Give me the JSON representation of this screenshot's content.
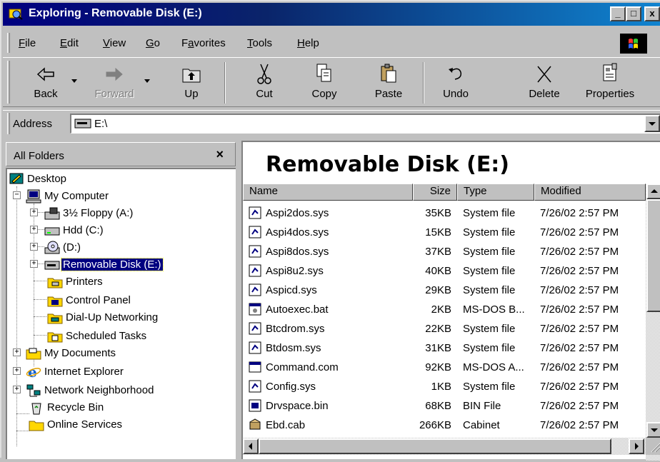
{
  "window": {
    "title": "Exploring - Removable Disk (E:)",
    "title_color": "#000080",
    "minimize_glyph": "_",
    "maximize_glyph": "□",
    "close_glyph": "x"
  },
  "menu": {
    "items": [
      {
        "accel": "F",
        "rest": "ile"
      },
      {
        "accel": "E",
        "rest": "dit"
      },
      {
        "accel": "V",
        "rest": "iew"
      },
      {
        "accel": "G",
        "rest": "o"
      },
      {
        "pre": "F",
        "accel": "a",
        "rest": "vorites"
      },
      {
        "accel": "T",
        "rest": "ools"
      },
      {
        "accel": "H",
        "rest": "elp"
      }
    ]
  },
  "toolbar": {
    "back": "Back",
    "forward": "Forward",
    "up": "Up",
    "cut": "Cut",
    "copy": "Copy",
    "paste": "Paste",
    "undo": "Undo",
    "delete": "Delete",
    "properties": "Properties"
  },
  "address": {
    "label": "Address",
    "value": "E:\\"
  },
  "folders": {
    "header": "All Folders",
    "close_glyph": "×",
    "tree": [
      {
        "label": "Desktop",
        "icon": "desktop-icon"
      },
      {
        "label": "My Computer",
        "icon": "computer-icon"
      },
      {
        "label": "3½ Floppy (A:)",
        "icon": "floppy-icon"
      },
      {
        "label": "Hdd (C:)",
        "icon": "hard-drive-icon"
      },
      {
        "label": " (D:)",
        "icon": "cd-drive-icon"
      },
      {
        "label": "Removable Disk (E:)",
        "icon": "removable-disk-icon"
      },
      {
        "label": "Printers",
        "icon": "printers-folder-icon"
      },
      {
        "label": "Control Panel",
        "icon": "control-panel-icon"
      },
      {
        "label": "Dial-Up Networking",
        "icon": "dialup-icon"
      },
      {
        "label": "Scheduled Tasks",
        "icon": "scheduled-tasks-icon"
      },
      {
        "label": "My Documents",
        "icon": "folder-icon"
      },
      {
        "label": "Internet Explorer",
        "icon": "ie-icon"
      },
      {
        "label": "Network Neighborhood",
        "icon": "network-icon"
      },
      {
        "label": "Recycle Bin",
        "icon": "recycle-bin-icon"
      },
      {
        "label": "Online Services",
        "icon": "folder-icon"
      }
    ]
  },
  "content": {
    "title": "Removable Disk (E:)",
    "columns": {
      "name": "Name",
      "size": "Size",
      "type": "Type",
      "modified": "Modified"
    },
    "files": [
      {
        "name": "Aspi2dos.sys",
        "size": "35KB",
        "type": "System file",
        "modified": "7/26/02 2:57 PM",
        "icon": "sys-file-icon"
      },
      {
        "name": "Aspi4dos.sys",
        "size": "15KB",
        "type": "System file",
        "modified": "7/26/02 2:57 PM",
        "icon": "sys-file-icon"
      },
      {
        "name": "Aspi8dos.sys",
        "size": "37KB",
        "type": "System file",
        "modified": "7/26/02 2:57 PM",
        "icon": "sys-file-icon"
      },
      {
        "name": "Aspi8u2.sys",
        "size": "40KB",
        "type": "System file",
        "modified": "7/26/02 2:57 PM",
        "icon": "sys-file-icon"
      },
      {
        "name": "Aspicd.sys",
        "size": "29KB",
        "type": "System file",
        "modified": "7/26/02 2:57 PM",
        "icon": "sys-file-icon"
      },
      {
        "name": "Autoexec.bat",
        "size": "2KB",
        "type": "MS-DOS B...",
        "modified": "7/26/02 2:57 PM",
        "icon": "bat-file-icon"
      },
      {
        "name": "Btcdrom.sys",
        "size": "22KB",
        "type": "System file",
        "modified": "7/26/02 2:57 PM",
        "icon": "sys-file-icon"
      },
      {
        "name": "Btdosm.sys",
        "size": "31KB",
        "type": "System file",
        "modified": "7/26/02 2:57 PM",
        "icon": "sys-file-icon"
      },
      {
        "name": "Command.com",
        "size": "92KB",
        "type": "MS-DOS A...",
        "modified": "7/26/02 2:57 PM",
        "icon": "com-file-icon"
      },
      {
        "name": "Config.sys",
        "size": "1KB",
        "type": "System file",
        "modified": "7/26/02 2:57 PM",
        "icon": "sys-file-icon"
      },
      {
        "name": "Drvspace.bin",
        "size": "68KB",
        "type": "BIN File",
        "modified": "7/26/02 2:57 PM",
        "icon": "bin-file-icon"
      },
      {
        "name": "Ebd.cab",
        "size": "266KB",
        "type": "Cabinet",
        "modified": "7/26/02 2:57 PM",
        "icon": "cab-file-icon"
      }
    ]
  }
}
